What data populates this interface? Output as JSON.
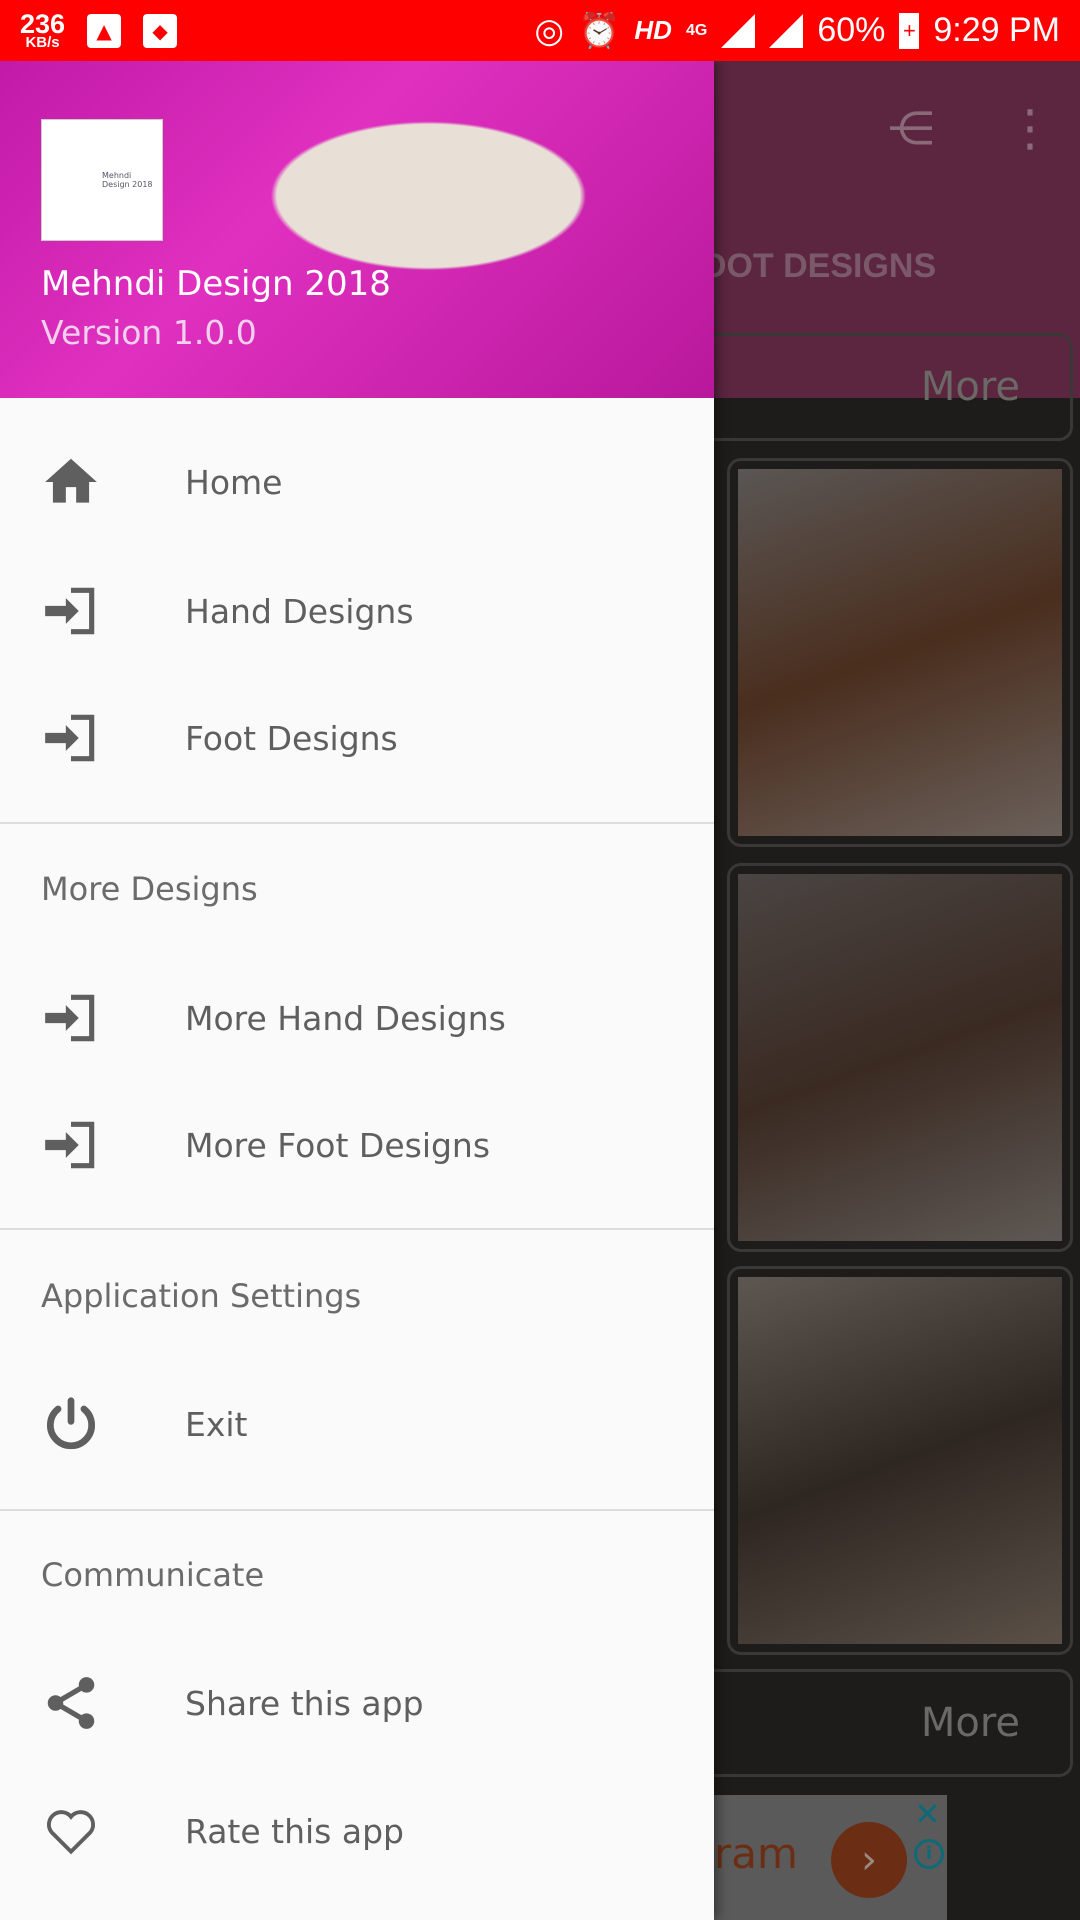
{
  "status_bar": {
    "speed": "236",
    "speed_unit": "KB/s",
    "network": "HD",
    "net_type": "4G",
    "battery": "60%",
    "time": "9:29 PM"
  },
  "background_app": {
    "tab_label": "OOT DESIGNS",
    "more_label": "More",
    "ad_text": "ram"
  },
  "drawer": {
    "app_name": "Mehndi Design 2018",
    "version": "Version 1.0.0",
    "logo_text": "Mehndi Design 2018",
    "items": [
      {
        "label": "Home",
        "icon": "home-icon"
      },
      {
        "label": "Hand Designs",
        "icon": "login-icon"
      },
      {
        "label": "Foot Designs",
        "icon": "login-icon"
      }
    ],
    "more_section": {
      "title": "More Designs",
      "items": [
        {
          "label": "More Hand Designs",
          "icon": "login-icon"
        },
        {
          "label": "More Foot Designs",
          "icon": "login-icon"
        }
      ]
    },
    "settings_section": {
      "title": "Application Settings",
      "items": [
        {
          "label": "Exit",
          "icon": "power-icon"
        }
      ]
    },
    "communicate_section": {
      "title": "Communicate",
      "items": [
        {
          "label": "Share this app",
          "icon": "share-icon"
        },
        {
          "label": "Rate this app",
          "icon": "heart-icon"
        }
      ]
    }
  },
  "colors": {
    "status_bar": "#ff0000",
    "app_bar": "#5c2540",
    "drawer_bg": "#fafafa"
  }
}
